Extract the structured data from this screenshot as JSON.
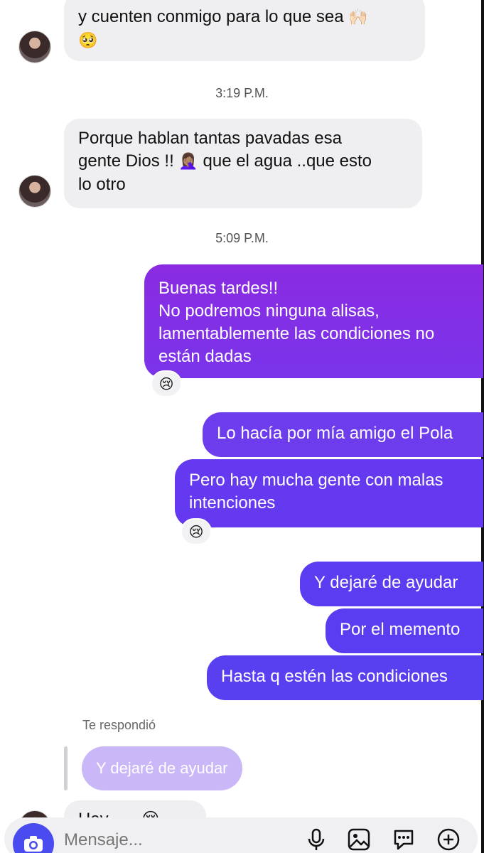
{
  "messages_in": [
    {
      "text_line1": "y cuenten conmigo para lo que sea",
      "emoji1": "🙌🏻",
      "emoji2": "🥺"
    },
    {
      "line1": "Porque hablan tantas pavadas esa",
      "line2": "gente Dios !!",
      "emoji": "🤦🏽‍♀️",
      "line2b": "que el agua ..que esto",
      "line3": "lo otro"
    }
  ],
  "timestamps": [
    "3:19 P.M.",
    "5:09 P.M."
  ],
  "messages_out": [
    {
      "lines": [
        "Buenas tardes!!",
        "No podremos ninguna alisas,",
        "lamentablemente las condiciones no",
        "están dadas"
      ],
      "reaction": "😢"
    },
    {
      "lines": [
        "Lo hacía por mía amigo el Pola"
      ]
    },
    {
      "lines": [
        "Pero hay mucha gente con malas",
        "intenciones"
      ],
      "reaction": "😢"
    },
    {
      "lines": [
        "Y dejaré de ayudar"
      ]
    },
    {
      "lines": [
        "Por el memento"
      ]
    },
    {
      "lines": [
        "Hasta q estén las condiciones"
      ]
    }
  ],
  "reply": {
    "label": "Te respondió",
    "quoted": "Y dejaré de ayudar",
    "partial_text": "Hay ......😢"
  },
  "composer": {
    "placeholder": "Mensaje..."
  },
  "colors": {
    "purple_top": "#8a2be2",
    "purple_bottom": "#5b3cf0",
    "camera": "#4a4cf0"
  },
  "icons": [
    "camera-icon",
    "microphone-icon",
    "image-icon",
    "sticker-icon",
    "plus-icon"
  ]
}
